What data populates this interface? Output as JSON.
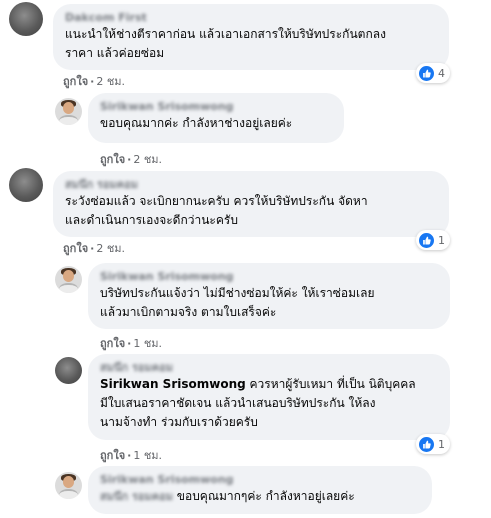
{
  "comments": [
    {
      "author": "Dakcom First",
      "lines": [
        "แนะนำให้ช่างตีราคาก่อน แล้วเอาเอกสารให้บริษัทประกันตกลง",
        "ราคา แล้วค่อยซ่อม"
      ],
      "like_label": "ถูกใจ",
      "time": "2 ชม.",
      "reaction_count": "4"
    },
    {
      "author": "Sirikwan Srisomwong",
      "lines": [
        "ขอบคุณมากค่ะ กำลังหาช่างอยู่เลยค่ะ"
      ],
      "like_label": "ถูกใจ",
      "time": "2 ชม."
    },
    {
      "author": "สมนึก รอมคอม",
      "lines": [
        "ระวังซ่อมแล้ว จะเบิกยากนะครับ ควรให้บริษัทประกัน จัดหา",
        "และดำเนินการเองจะดีกว่านะครับ"
      ],
      "like_label": "ถูกใจ",
      "time": "2 ชม.",
      "reaction_count": "1"
    },
    {
      "author": "Sirikwan Srisomwong",
      "lines": [
        "บริษัทประกันแจ้งว่า ไม่มีช่างซ่อมให้ค่ะ ให้เราซ่อมเลย",
        "แล้วมาเบิกตามจริง ตามใบเสร็จค่ะ"
      ],
      "like_label": "ถูกใจ",
      "time": "1 ชม."
    },
    {
      "author": "สมนึก รอมคอม",
      "tagged_name": "Sirikwan Srisomwong",
      "lines": [
        " ควรหาผู้รับเหมา ที่เป็น นิติบุคคล",
        "มีใบเสนอราคาชัดเจน แล้วนำเสนอบริษัทประกัน ให้ลง",
        "นามจ้างทำ ร่วมกับเราด้วยครับ"
      ],
      "like_label": "ถูกใจ",
      "time": "1 ชม.",
      "reaction_count": "1"
    },
    {
      "author": "Sirikwan Srisomwong",
      "tagged_name": "สมนึก รอมคอม",
      "lines": [
        " ขอบคุณมากๆค่ะ กำลังหาอยู่เลยค่ะ"
      ]
    }
  ],
  "colors": {
    "bubble": "#f0f2f5",
    "like_blue": "#1877f2",
    "meta_gray": "#65676b"
  },
  "icons": {
    "like": "thumbs-up-icon"
  }
}
